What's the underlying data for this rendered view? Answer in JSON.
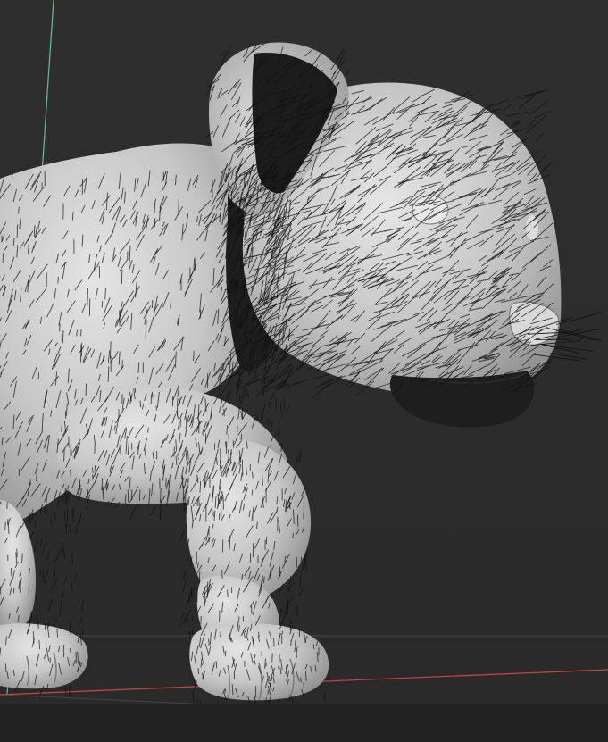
{
  "viewport": {
    "background": "#2b2b2b",
    "model": "lion-cub-fur-render",
    "shading": "solid-grey-with-black-hair-strands"
  },
  "axes": {
    "x_axis_color": "#c8463c",
    "y_axis_color": "#5fc58c",
    "grid_color": "#4a4a4a"
  },
  "colors": {
    "body": "#c4c4c4",
    "fur": "#111111",
    "shadow": "#1c1c1c"
  }
}
